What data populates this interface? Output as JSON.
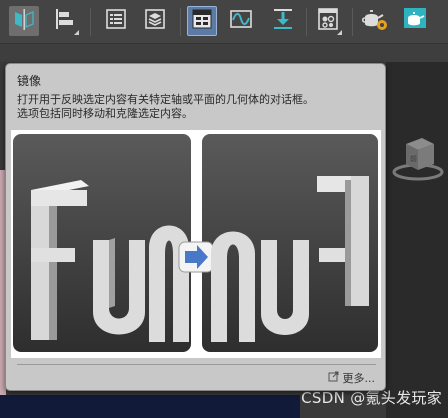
{
  "toolbar": {
    "buttons": [
      {
        "name": "mirror-button",
        "icon": "mirror-icon",
        "state": "selected"
      },
      {
        "name": "align-button",
        "icon": "align-icon",
        "state": "normal"
      },
      {
        "name": "scene-explorer-button",
        "icon": "list-icon",
        "state": "normal"
      },
      {
        "name": "layer-explorer-button",
        "icon": "layers-icon",
        "state": "normal"
      },
      {
        "name": "ribbon-button",
        "icon": "ribbon-icon",
        "state": "active"
      },
      {
        "name": "curve-editor-button",
        "icon": "curve-icon",
        "state": "normal"
      },
      {
        "name": "dope-sheet-button",
        "icon": "download-icon",
        "state": "normal"
      },
      {
        "name": "material-editor-button",
        "icon": "material-icon",
        "state": "normal"
      },
      {
        "name": "render-setup-button",
        "icon": "teapot-gear-icon",
        "state": "normal"
      },
      {
        "name": "rendered-frame-button",
        "icon": "teapot-frame-icon",
        "state": "normal"
      }
    ]
  },
  "tooltip": {
    "title": "镜像",
    "description_lines": [
      "打开用于反映选定内容有关特定轴或平面的几何体的对话框。",
      "选项包括同时移动和克隆选定内容。"
    ],
    "illustration": {
      "left_text": "Fun",
      "right_text": "Fun",
      "arrow": "arrow-right-icon"
    },
    "more_link": "更多..."
  },
  "watermark": "CSDN @氪头发玩家",
  "colors": {
    "toolbar_bg": "#444444",
    "accent": "#5b7aa6",
    "tooltip_bg": "#c8c8c8"
  }
}
